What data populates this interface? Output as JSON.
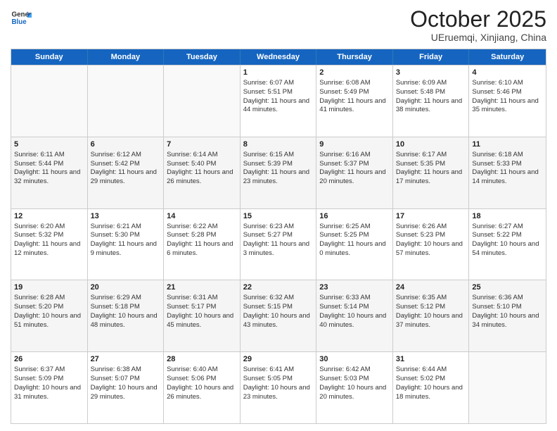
{
  "header": {
    "logo_line1": "General",
    "logo_line2": "Blue",
    "month": "October 2025",
    "location": "UEruemqi, Xinjiang, China"
  },
  "weekdays": [
    "Sunday",
    "Monday",
    "Tuesday",
    "Wednesday",
    "Thursday",
    "Friday",
    "Saturday"
  ],
  "rows": [
    [
      {
        "day": "",
        "info": ""
      },
      {
        "day": "",
        "info": ""
      },
      {
        "day": "",
        "info": ""
      },
      {
        "day": "1",
        "info": "Sunrise: 6:07 AM\nSunset: 5:51 PM\nDaylight: 11 hours and 44 minutes."
      },
      {
        "day": "2",
        "info": "Sunrise: 6:08 AM\nSunset: 5:49 PM\nDaylight: 11 hours and 41 minutes."
      },
      {
        "day": "3",
        "info": "Sunrise: 6:09 AM\nSunset: 5:48 PM\nDaylight: 11 hours and 38 minutes."
      },
      {
        "day": "4",
        "info": "Sunrise: 6:10 AM\nSunset: 5:46 PM\nDaylight: 11 hours and 35 minutes."
      }
    ],
    [
      {
        "day": "5",
        "info": "Sunrise: 6:11 AM\nSunset: 5:44 PM\nDaylight: 11 hours and 32 minutes."
      },
      {
        "day": "6",
        "info": "Sunrise: 6:12 AM\nSunset: 5:42 PM\nDaylight: 11 hours and 29 minutes."
      },
      {
        "day": "7",
        "info": "Sunrise: 6:14 AM\nSunset: 5:40 PM\nDaylight: 11 hours and 26 minutes."
      },
      {
        "day": "8",
        "info": "Sunrise: 6:15 AM\nSunset: 5:39 PM\nDaylight: 11 hours and 23 minutes."
      },
      {
        "day": "9",
        "info": "Sunrise: 6:16 AM\nSunset: 5:37 PM\nDaylight: 11 hours and 20 minutes."
      },
      {
        "day": "10",
        "info": "Sunrise: 6:17 AM\nSunset: 5:35 PM\nDaylight: 11 hours and 17 minutes."
      },
      {
        "day": "11",
        "info": "Sunrise: 6:18 AM\nSunset: 5:33 PM\nDaylight: 11 hours and 14 minutes."
      }
    ],
    [
      {
        "day": "12",
        "info": "Sunrise: 6:20 AM\nSunset: 5:32 PM\nDaylight: 11 hours and 12 minutes."
      },
      {
        "day": "13",
        "info": "Sunrise: 6:21 AM\nSunset: 5:30 PM\nDaylight: 11 hours and 9 minutes."
      },
      {
        "day": "14",
        "info": "Sunrise: 6:22 AM\nSunset: 5:28 PM\nDaylight: 11 hours and 6 minutes."
      },
      {
        "day": "15",
        "info": "Sunrise: 6:23 AM\nSunset: 5:27 PM\nDaylight: 11 hours and 3 minutes."
      },
      {
        "day": "16",
        "info": "Sunrise: 6:25 AM\nSunset: 5:25 PM\nDaylight: 11 hours and 0 minutes."
      },
      {
        "day": "17",
        "info": "Sunrise: 6:26 AM\nSunset: 5:23 PM\nDaylight: 10 hours and 57 minutes."
      },
      {
        "day": "18",
        "info": "Sunrise: 6:27 AM\nSunset: 5:22 PM\nDaylight: 10 hours and 54 minutes."
      }
    ],
    [
      {
        "day": "19",
        "info": "Sunrise: 6:28 AM\nSunset: 5:20 PM\nDaylight: 10 hours and 51 minutes."
      },
      {
        "day": "20",
        "info": "Sunrise: 6:29 AM\nSunset: 5:18 PM\nDaylight: 10 hours and 48 minutes."
      },
      {
        "day": "21",
        "info": "Sunrise: 6:31 AM\nSunset: 5:17 PM\nDaylight: 10 hours and 45 minutes."
      },
      {
        "day": "22",
        "info": "Sunrise: 6:32 AM\nSunset: 5:15 PM\nDaylight: 10 hours and 43 minutes."
      },
      {
        "day": "23",
        "info": "Sunrise: 6:33 AM\nSunset: 5:14 PM\nDaylight: 10 hours and 40 minutes."
      },
      {
        "day": "24",
        "info": "Sunrise: 6:35 AM\nSunset: 5:12 PM\nDaylight: 10 hours and 37 minutes."
      },
      {
        "day": "25",
        "info": "Sunrise: 6:36 AM\nSunset: 5:10 PM\nDaylight: 10 hours and 34 minutes."
      }
    ],
    [
      {
        "day": "26",
        "info": "Sunrise: 6:37 AM\nSunset: 5:09 PM\nDaylight: 10 hours and 31 minutes."
      },
      {
        "day": "27",
        "info": "Sunrise: 6:38 AM\nSunset: 5:07 PM\nDaylight: 10 hours and 29 minutes."
      },
      {
        "day": "28",
        "info": "Sunrise: 6:40 AM\nSunset: 5:06 PM\nDaylight: 10 hours and 26 minutes."
      },
      {
        "day": "29",
        "info": "Sunrise: 6:41 AM\nSunset: 5:05 PM\nDaylight: 10 hours and 23 minutes."
      },
      {
        "day": "30",
        "info": "Sunrise: 6:42 AM\nSunset: 5:03 PM\nDaylight: 10 hours and 20 minutes."
      },
      {
        "day": "31",
        "info": "Sunrise: 6:44 AM\nSunset: 5:02 PM\nDaylight: 10 hours and 18 minutes."
      },
      {
        "day": "",
        "info": ""
      }
    ]
  ]
}
